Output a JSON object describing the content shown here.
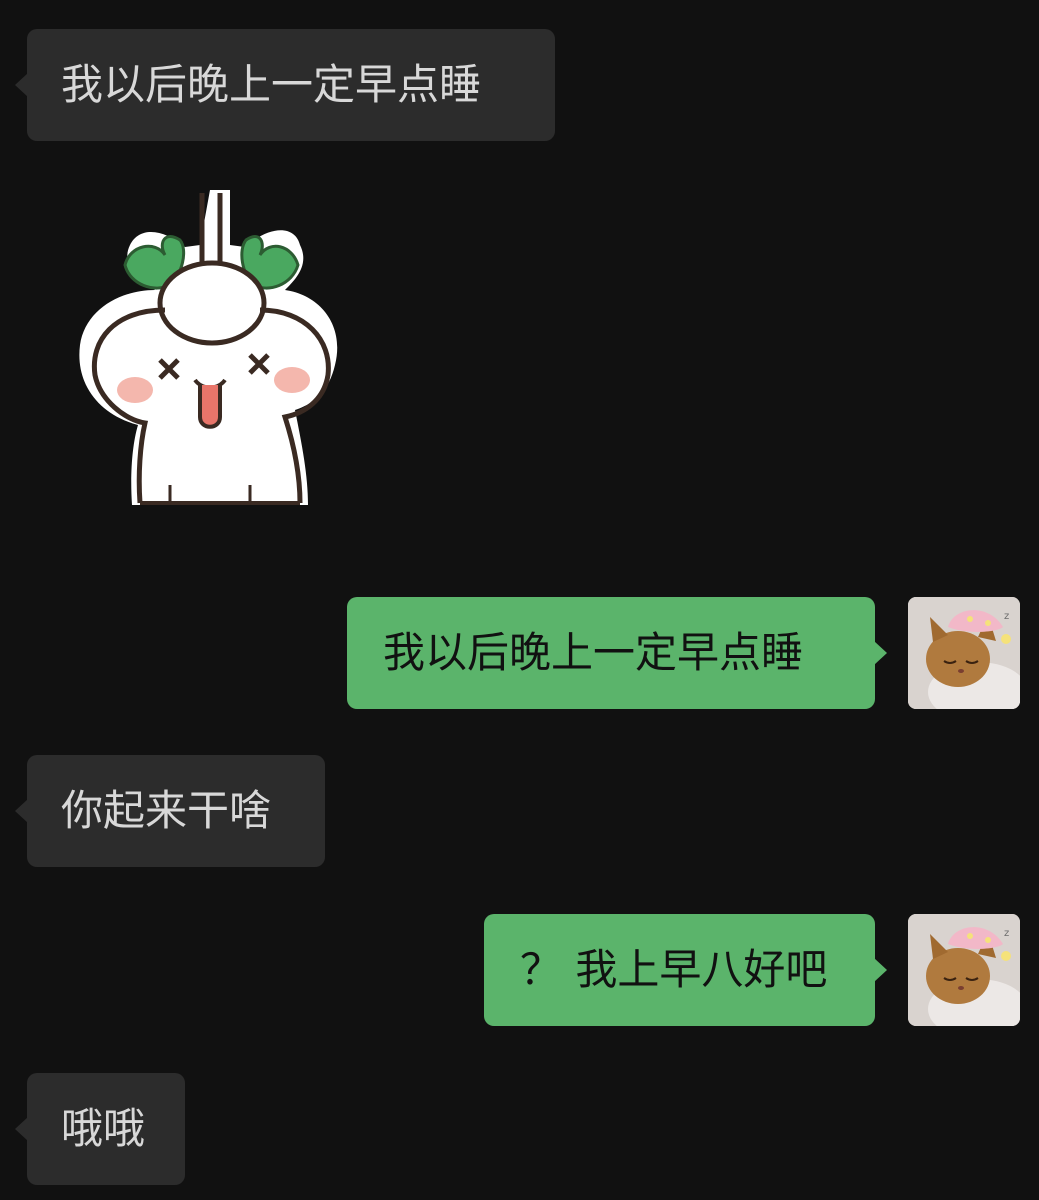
{
  "messages": [
    {
      "side": "left",
      "text": "我以后晚上一定早点睡"
    },
    {
      "side": "left",
      "type": "sticker",
      "sticker_icon": "dizzy-radish-sticker"
    },
    {
      "side": "right",
      "text": "我以后晚上一定早点睡",
      "avatar_icon": "sleeping-cat-avatar"
    },
    {
      "side": "left",
      "text": "你起来干啥"
    },
    {
      "side": "right",
      "text": "？ 我上早八好吧",
      "avatar_icon": "sleeping-cat-avatar"
    },
    {
      "side": "left",
      "text": "哦哦"
    }
  ],
  "colors": {
    "background": "#111111",
    "incoming_bubble": "#2c2c2c",
    "outgoing_bubble": "#5bb46b",
    "incoming_text": "#d8d8d8",
    "outgoing_text": "#111111"
  }
}
